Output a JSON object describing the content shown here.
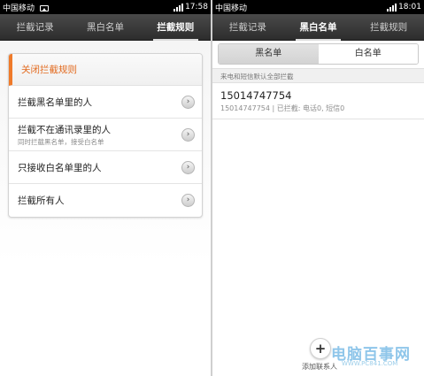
{
  "left_screen": {
    "status": {
      "carrier": "中国移动",
      "time": "17:58"
    },
    "tabs": [
      {
        "label": "拦截记录",
        "active": false
      },
      {
        "label": "黑白名单",
        "active": false
      },
      {
        "label": "拦截规则",
        "active": true
      }
    ],
    "rules_card": {
      "header": "关闭拦截规则",
      "items": [
        {
          "label": "拦截黑名单里的人",
          "sub": ""
        },
        {
          "label": "拦截不在通讯录里的人",
          "sub": "同时拦截黑名单，接受白名单"
        },
        {
          "label": "只接收白名单里的人",
          "sub": ""
        },
        {
          "label": "拦截所有人",
          "sub": ""
        }
      ],
      "arrow": "›"
    }
  },
  "right_screen": {
    "status": {
      "carrier": "中国移动",
      "time": "18:01"
    },
    "tabs": [
      {
        "label": "拦截记录",
        "active": false
      },
      {
        "label": "黑白名单",
        "active": true
      },
      {
        "label": "拦截规则",
        "active": false
      }
    ],
    "segment": {
      "left": "黑名单",
      "right": "白名单"
    },
    "info": "来电和短信默认全部拦截",
    "entry": {
      "number": "15014747754",
      "detail": "15014747754 | 已拦截: 电话0, 短信0"
    },
    "add_label": "添加联系人",
    "add_glyph": "+"
  },
  "watermark": {
    "main": "电脑百事网",
    "sub": "WWW.PC841.COM"
  },
  "colors": {
    "accent_orange": "#e2691d",
    "tabbar": "#3a3a3a",
    "statusbar": "#000000"
  }
}
